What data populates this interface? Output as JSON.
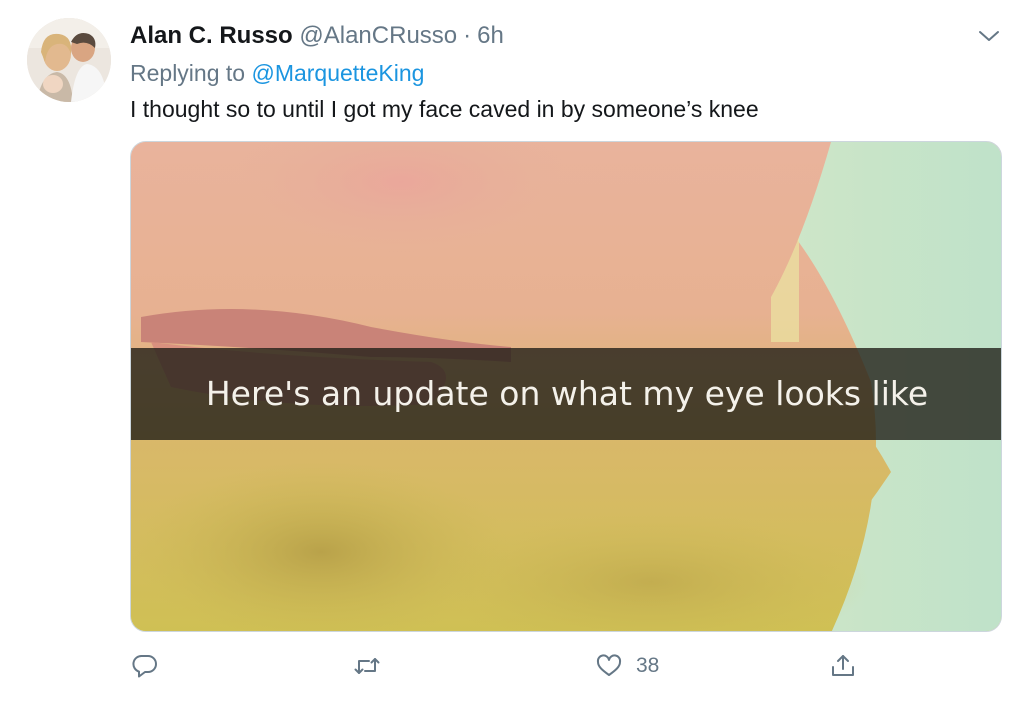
{
  "tweet": {
    "author": {
      "display_name": "Alan C. Russo",
      "handle": "@AlanCRusso",
      "separator": "·",
      "time": "6h",
      "avatar_icon": "profile-photo"
    },
    "replying_to": {
      "prefix": "Replying to",
      "mention": "@MarquetteKing"
    },
    "text": "I thought so to until I got my face caved in by someone’s knee",
    "media": {
      "caption": "Here's an update on what my eye looks like"
    },
    "menu_icon": "chevron-down-icon"
  },
  "actions": {
    "reply": {
      "icon": "reply-icon",
      "count": ""
    },
    "retweet": {
      "icon": "retweet-icon",
      "count": ""
    },
    "like": {
      "icon": "heart-icon",
      "count": "38"
    },
    "share": {
      "icon": "share-icon",
      "count": ""
    }
  },
  "colors": {
    "text": "#14171a",
    "secondary": "#657786",
    "link": "#1b95e0",
    "border": "#ccd6dd"
  }
}
